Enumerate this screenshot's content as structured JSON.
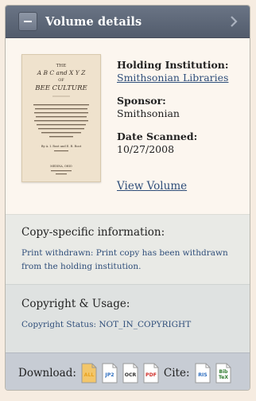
{
  "header": {
    "title": "Volume details"
  },
  "book": {
    "cover_title_lines": [
      "THE",
      "A B C and X Y Z",
      "OF",
      "BEE CULTURE"
    ],
    "cover_body": "A Cyclopedia of Everything Pertaining to the Care of the Honey-Bee",
    "cover_authors": "By A. I. Root and E. R. Root",
    "cover_publisher": "MEDINA, OHIO"
  },
  "details": {
    "holding_label": "Holding Institution:",
    "holding_value": "Smithsonian Libraries",
    "sponsor_label": "Sponsor:",
    "sponsor_value": "Smithsonian",
    "date_label": "Date Scanned:",
    "date_value": "10/27/2008",
    "view_volume": "View Volume"
  },
  "copy_specific": {
    "title": "Copy-specific information:",
    "text": "Print withdrawn: Print copy has been withdrawn from the holding institution."
  },
  "copyright": {
    "title": "Copyright & Usage:",
    "text": "Copyright Status: NOT_IN_COPYRIGHT"
  },
  "footer": {
    "download_label": "Download:",
    "cite_label": "Cite:",
    "download_icons": [
      {
        "name": "all-download-icon",
        "text": "ALL",
        "color": "#e8a321"
      },
      {
        "name": "jp2-download-icon",
        "text": "JP2",
        "color": "#2f6fc0"
      },
      {
        "name": "ocr-download-icon",
        "text": "OCR",
        "color": "#333333"
      },
      {
        "name": "pdf-download-icon",
        "text": "PDF",
        "color": "#d0312d"
      }
    ],
    "cite_icons": [
      {
        "name": "ris-cite-icon",
        "text": "RIS",
        "color": "#2f6fc0"
      },
      {
        "name": "bibtex-cite-icon",
        "text": "BibTeX",
        "color": "#2d7a2d"
      }
    ]
  }
}
